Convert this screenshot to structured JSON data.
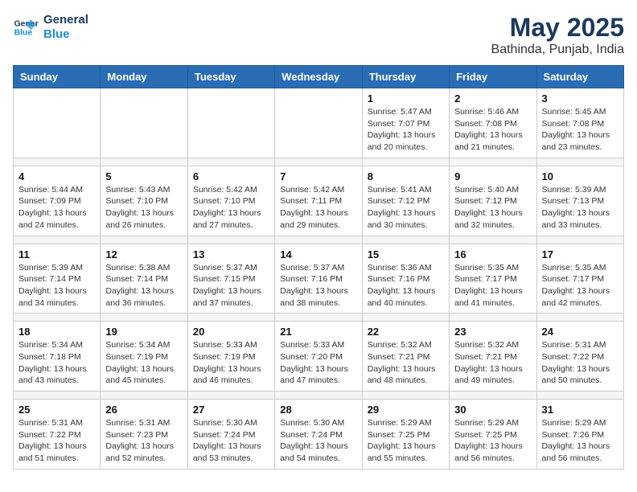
{
  "header": {
    "logo_line1": "General",
    "logo_line2": "Blue",
    "month": "May 2025",
    "location": "Bathinda, Punjab, India"
  },
  "days_of_week": [
    "Sunday",
    "Monday",
    "Tuesday",
    "Wednesday",
    "Thursday",
    "Friday",
    "Saturday"
  ],
  "weeks": [
    [
      {
        "day": "",
        "sunrise": "",
        "sunset": "",
        "daylight": ""
      },
      {
        "day": "",
        "sunrise": "",
        "sunset": "",
        "daylight": ""
      },
      {
        "day": "",
        "sunrise": "",
        "sunset": "",
        "daylight": ""
      },
      {
        "day": "",
        "sunrise": "",
        "sunset": "",
        "daylight": ""
      },
      {
        "day": "1",
        "sunrise": "Sunrise: 5:47 AM",
        "sunset": "Sunset: 7:07 PM",
        "daylight": "Daylight: 13 hours and 20 minutes."
      },
      {
        "day": "2",
        "sunrise": "Sunrise: 5:46 AM",
        "sunset": "Sunset: 7:08 PM",
        "daylight": "Daylight: 13 hours and 21 minutes."
      },
      {
        "day": "3",
        "sunrise": "Sunrise: 5:45 AM",
        "sunset": "Sunset: 7:08 PM",
        "daylight": "Daylight: 13 hours and 23 minutes."
      }
    ],
    [
      {
        "day": "4",
        "sunrise": "Sunrise: 5:44 AM",
        "sunset": "Sunset: 7:09 PM",
        "daylight": "Daylight: 13 hours and 24 minutes."
      },
      {
        "day": "5",
        "sunrise": "Sunrise: 5:43 AM",
        "sunset": "Sunset: 7:10 PM",
        "daylight": "Daylight: 13 hours and 26 minutes."
      },
      {
        "day": "6",
        "sunrise": "Sunrise: 5:42 AM",
        "sunset": "Sunset: 7:10 PM",
        "daylight": "Daylight: 13 hours and 27 minutes."
      },
      {
        "day": "7",
        "sunrise": "Sunrise: 5:42 AM",
        "sunset": "Sunset: 7:11 PM",
        "daylight": "Daylight: 13 hours and 29 minutes."
      },
      {
        "day": "8",
        "sunrise": "Sunrise: 5:41 AM",
        "sunset": "Sunset: 7:12 PM",
        "daylight": "Daylight: 13 hours and 30 minutes."
      },
      {
        "day": "9",
        "sunrise": "Sunrise: 5:40 AM",
        "sunset": "Sunset: 7:12 PM",
        "daylight": "Daylight: 13 hours and 32 minutes."
      },
      {
        "day": "10",
        "sunrise": "Sunrise: 5:39 AM",
        "sunset": "Sunset: 7:13 PM",
        "daylight": "Daylight: 13 hours and 33 minutes."
      }
    ],
    [
      {
        "day": "11",
        "sunrise": "Sunrise: 5:39 AM",
        "sunset": "Sunset: 7:14 PM",
        "daylight": "Daylight: 13 hours and 34 minutes."
      },
      {
        "day": "12",
        "sunrise": "Sunrise: 5:38 AM",
        "sunset": "Sunset: 7:14 PM",
        "daylight": "Daylight: 13 hours and 36 minutes."
      },
      {
        "day": "13",
        "sunrise": "Sunrise: 5:37 AM",
        "sunset": "Sunset: 7:15 PM",
        "daylight": "Daylight: 13 hours and 37 minutes."
      },
      {
        "day": "14",
        "sunrise": "Sunrise: 5:37 AM",
        "sunset": "Sunset: 7:16 PM",
        "daylight": "Daylight: 13 hours and 38 minutes."
      },
      {
        "day": "15",
        "sunrise": "Sunrise: 5:36 AM",
        "sunset": "Sunset: 7:16 PM",
        "daylight": "Daylight: 13 hours and 40 minutes."
      },
      {
        "day": "16",
        "sunrise": "Sunrise: 5:35 AM",
        "sunset": "Sunset: 7:17 PM",
        "daylight": "Daylight: 13 hours and 41 minutes."
      },
      {
        "day": "17",
        "sunrise": "Sunrise: 5:35 AM",
        "sunset": "Sunset: 7:17 PM",
        "daylight": "Daylight: 13 hours and 42 minutes."
      }
    ],
    [
      {
        "day": "18",
        "sunrise": "Sunrise: 5:34 AM",
        "sunset": "Sunset: 7:18 PM",
        "daylight": "Daylight: 13 hours and 43 minutes."
      },
      {
        "day": "19",
        "sunrise": "Sunrise: 5:34 AM",
        "sunset": "Sunset: 7:19 PM",
        "daylight": "Daylight: 13 hours and 45 minutes."
      },
      {
        "day": "20",
        "sunrise": "Sunrise: 5:33 AM",
        "sunset": "Sunset: 7:19 PM",
        "daylight": "Daylight: 13 hours and 46 minutes."
      },
      {
        "day": "21",
        "sunrise": "Sunrise: 5:33 AM",
        "sunset": "Sunset: 7:20 PM",
        "daylight": "Daylight: 13 hours and 47 minutes."
      },
      {
        "day": "22",
        "sunrise": "Sunrise: 5:32 AM",
        "sunset": "Sunset: 7:21 PM",
        "daylight": "Daylight: 13 hours and 48 minutes."
      },
      {
        "day": "23",
        "sunrise": "Sunrise: 5:32 AM",
        "sunset": "Sunset: 7:21 PM",
        "daylight": "Daylight: 13 hours and 49 minutes."
      },
      {
        "day": "24",
        "sunrise": "Sunrise: 5:31 AM",
        "sunset": "Sunset: 7:22 PM",
        "daylight": "Daylight: 13 hours and 50 minutes."
      }
    ],
    [
      {
        "day": "25",
        "sunrise": "Sunrise: 5:31 AM",
        "sunset": "Sunset: 7:22 PM",
        "daylight": "Daylight: 13 hours and 51 minutes."
      },
      {
        "day": "26",
        "sunrise": "Sunrise: 5:31 AM",
        "sunset": "Sunset: 7:23 PM",
        "daylight": "Daylight: 13 hours and 52 minutes."
      },
      {
        "day": "27",
        "sunrise": "Sunrise: 5:30 AM",
        "sunset": "Sunset: 7:24 PM",
        "daylight": "Daylight: 13 hours and 53 minutes."
      },
      {
        "day": "28",
        "sunrise": "Sunrise: 5:30 AM",
        "sunset": "Sunset: 7:24 PM",
        "daylight": "Daylight: 13 hours and 54 minutes."
      },
      {
        "day": "29",
        "sunrise": "Sunrise: 5:29 AM",
        "sunset": "Sunset: 7:25 PM",
        "daylight": "Daylight: 13 hours and 55 minutes."
      },
      {
        "day": "30",
        "sunrise": "Sunrise: 5:29 AM",
        "sunset": "Sunset: 7:25 PM",
        "daylight": "Daylight: 13 hours and 56 minutes."
      },
      {
        "day": "31",
        "sunrise": "Sunrise: 5:29 AM",
        "sunset": "Sunset: 7:26 PM",
        "daylight": "Daylight: 13 hours and 56 minutes."
      }
    ]
  ]
}
